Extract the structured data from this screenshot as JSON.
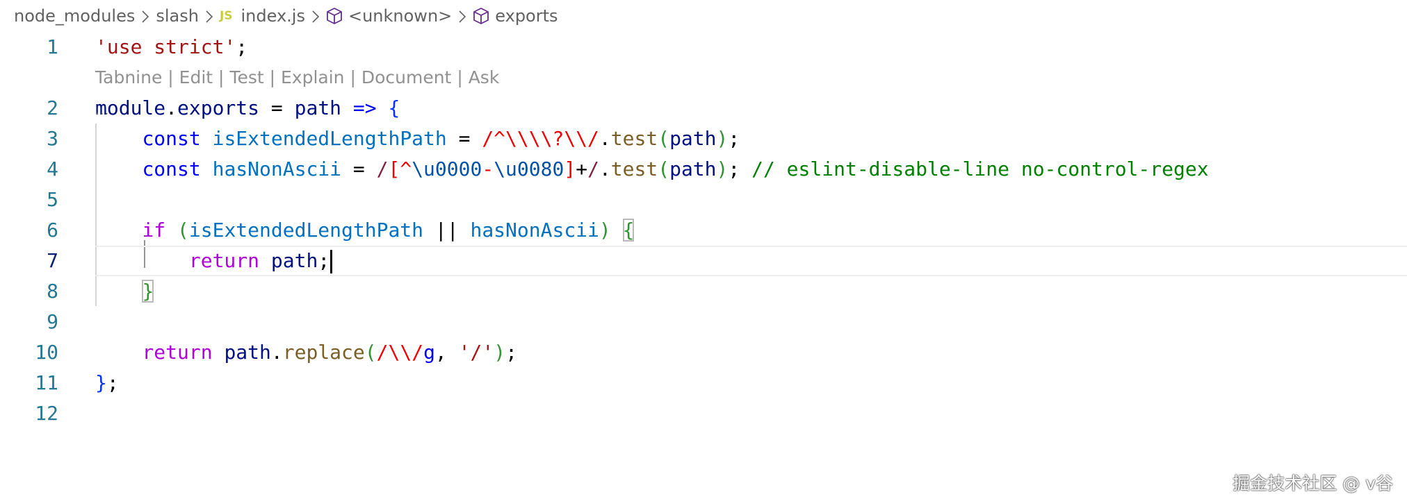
{
  "breadcrumb": {
    "items": [
      "node_modules",
      "slash",
      "index.js",
      "<unknown>",
      "exports"
    ],
    "file_badge": "JS"
  },
  "codelens": {
    "items": [
      "Tabnine",
      "Edit",
      "Test",
      "Explain",
      "Document",
      "Ask"
    ],
    "separator": "|"
  },
  "line_numbers": [
    "1",
    "2",
    "3",
    "4",
    "5",
    "6",
    "7",
    "8",
    "9",
    "10",
    "11",
    "12"
  ],
  "active_line": "7",
  "code": {
    "l1": {
      "str": "'use strict'",
      "semi": ";"
    },
    "l2": {
      "mod": "module",
      "dot": ".",
      "exports": "exports",
      "eq": " = ",
      "param": "path",
      "arrow": " => ",
      "brace": "{"
    },
    "l3": {
      "indent": "    ",
      "kw": "const",
      "sp": " ",
      "name": "isExtendedLengthPath",
      "eq": " = ",
      "rx": "/^\\\\\\\\?\\\\/",
      "dot": ".",
      "fn": "test",
      "open": "(",
      "arg": "path",
      "close": ")",
      "semi": ";"
    },
    "l4": {
      "indent": "    ",
      "kw": "const",
      "sp": " ",
      "name": "hasNonAscii",
      "eq": " = ",
      "rx_start": "/",
      "cls_open": "[",
      "caret": "^",
      "esc1": "\\u0000",
      "dash": "-",
      "esc2": "\\u0080",
      "cls_close": "]",
      "plus": "+",
      "rx_end": "/",
      "dot": ".",
      "fn": "test",
      "open": "(",
      "arg": "path",
      "close": ")",
      "semi": "; ",
      "comment": "// eslint-disable-line no-control-regex"
    },
    "l6": {
      "indent": "    ",
      "kw": "if",
      "sp": " ",
      "open": "(",
      "a": "isExtendedLengthPath",
      "or": " || ",
      "b": "hasNonAscii",
      "close": ")",
      "sp2": " ",
      "brace": "{"
    },
    "l7": {
      "indent": "        ",
      "kw": "return",
      "sp": " ",
      "val": "path",
      "semi": ";"
    },
    "l8": {
      "indent": "    ",
      "brace": "}"
    },
    "l10": {
      "indent": "    ",
      "kw": "return",
      "sp": " ",
      "obj": "path",
      "dot": ".",
      "fn": "replace",
      "open": "(",
      "rx": "/\\\\/",
      "flag": "g",
      "comma": ", ",
      "str": "'/'",
      "close": ")",
      "semi": ";"
    },
    "l11": {
      "brace": "}",
      "semi": ";"
    }
  },
  "watermark": "掘金技术社区 @ v谷",
  "colors": {
    "line_number": "#237893",
    "active_line_number": "#0b216f",
    "string": "#a31515",
    "keyword": "#0000ff",
    "control_keyword": "#af00db",
    "variable": "#001080",
    "constant": "#0070c1",
    "function": "#795e26",
    "comment": "#008000",
    "codelens": "#919191"
  }
}
